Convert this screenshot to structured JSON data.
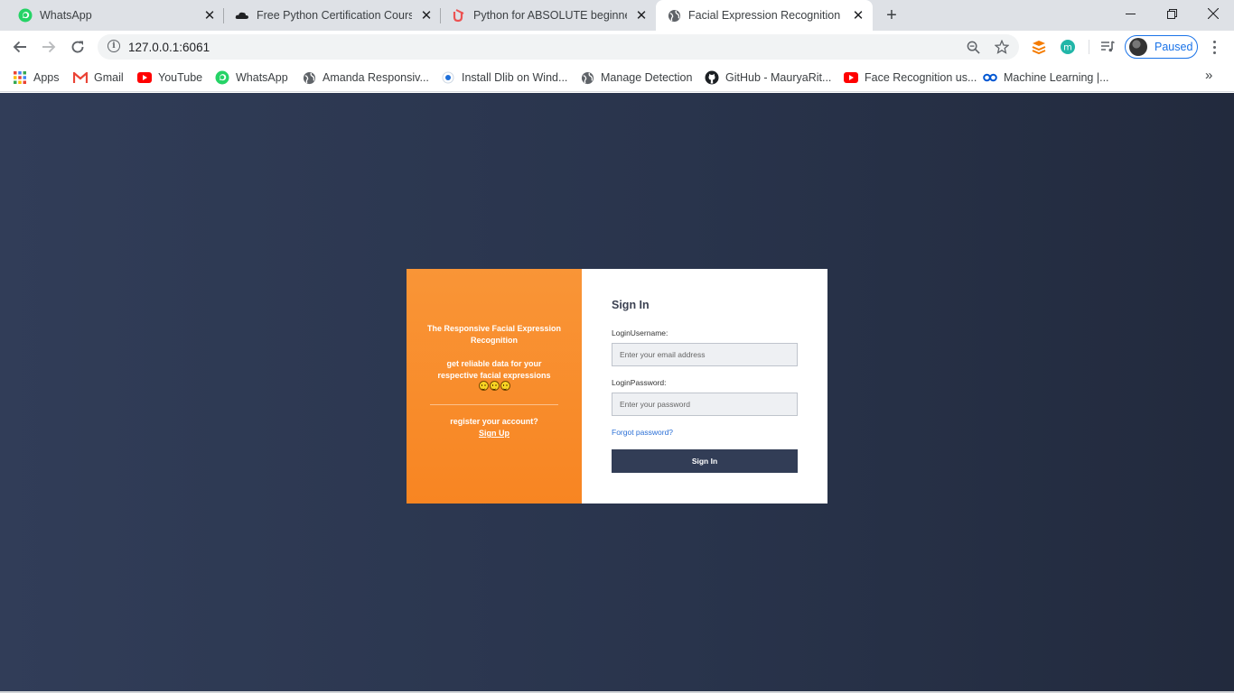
{
  "browser": {
    "tabs": [
      {
        "title": "WhatsApp",
        "icon": "whatsapp-icon"
      },
      {
        "title": "Free Python Certification Course",
        "icon": "cloud-icon"
      },
      {
        "title": "Python for ABSOLUTE beginners!",
        "icon": "udemy-icon"
      },
      {
        "title": "Facial Expression Recognition",
        "icon": "globe-icon",
        "active": true
      }
    ],
    "url": "127.0.0.1:6061",
    "profile_status": "Paused",
    "bookmarks": [
      {
        "label": "Apps",
        "icon": "apps-grid-icon"
      },
      {
        "label": "Gmail",
        "icon": "gmail-icon"
      },
      {
        "label": "YouTube",
        "icon": "youtube-icon"
      },
      {
        "label": "WhatsApp",
        "icon": "whatsapp-icon"
      },
      {
        "label": "Amanda Responsiv...",
        "icon": "globe-icon"
      },
      {
        "label": "Install Dlib on Wind...",
        "icon": "record-icon"
      },
      {
        "label": "Manage Detection",
        "icon": "globe-icon"
      },
      {
        "label": "GitHub - MauryaRit...",
        "icon": "github-icon"
      },
      {
        "label": "Face Recognition us...",
        "icon": "youtube-icon"
      },
      {
        "label": "Machine Learning |...",
        "icon": "coursera-icon"
      }
    ]
  },
  "login_page": {
    "promo": {
      "tagline": "The Responsive Facial Expression Recognition",
      "subtitle": "get reliable data for your respective facial expressions",
      "register_prompt": "register your account?",
      "signup_link": "Sign Up"
    },
    "form": {
      "heading": "Sign In",
      "username_label": "LoginUsername:",
      "username_placeholder": "Enter your email address",
      "password_label": "LoginPassword:",
      "password_placeholder": "Enter your password",
      "forgot_link": "Forgot password?",
      "submit_label": "Sign In"
    }
  },
  "colors": {
    "background": "#2b3650",
    "promo_orange": "#f88a2a",
    "button": "#323d56",
    "link": "#2a6fd6"
  }
}
